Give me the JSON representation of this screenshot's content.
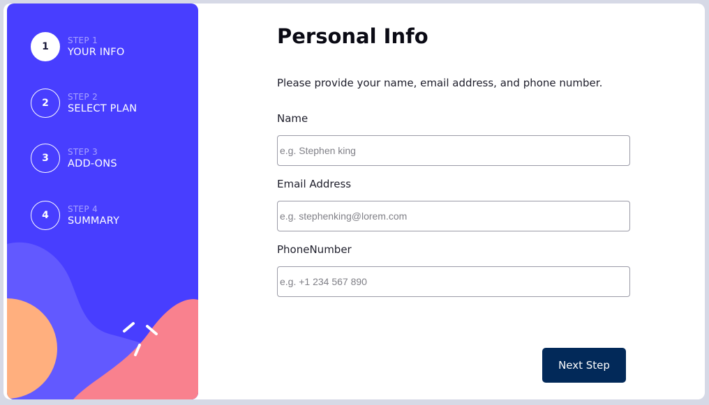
{
  "steps": [
    {
      "num": "1",
      "label": "STEP 1",
      "title": "YOUR INFO",
      "active": true
    },
    {
      "num": "2",
      "label": "STEP 2",
      "title": "SELECT PLAN",
      "active": false
    },
    {
      "num": "3",
      "label": "STEP 3",
      "title": "ADD-ONS",
      "active": false
    },
    {
      "num": "4",
      "label": "STEP 4",
      "title": "SUMMARY",
      "active": false
    }
  ],
  "form": {
    "title": "Personal Info",
    "subtitle": "Please provide your name, email address, and phone number.",
    "name": {
      "label": "Name",
      "placeholder": "e.g. Stephen king",
      "value": ""
    },
    "email": {
      "label": "Email Address",
      "placeholder": "e.g. stephenking@lorem.com",
      "value": ""
    },
    "phone": {
      "label": "PhoneNumber",
      "placeholder": "e.g. +1 234 567 890",
      "value": ""
    },
    "next_label": "Next Step"
  },
  "colors": {
    "sidebar": "#483eff",
    "button": "#022959",
    "blob_orange": "#ffaf7e",
    "blob_pink": "#f9818e",
    "blob_light": "#6259ff"
  }
}
